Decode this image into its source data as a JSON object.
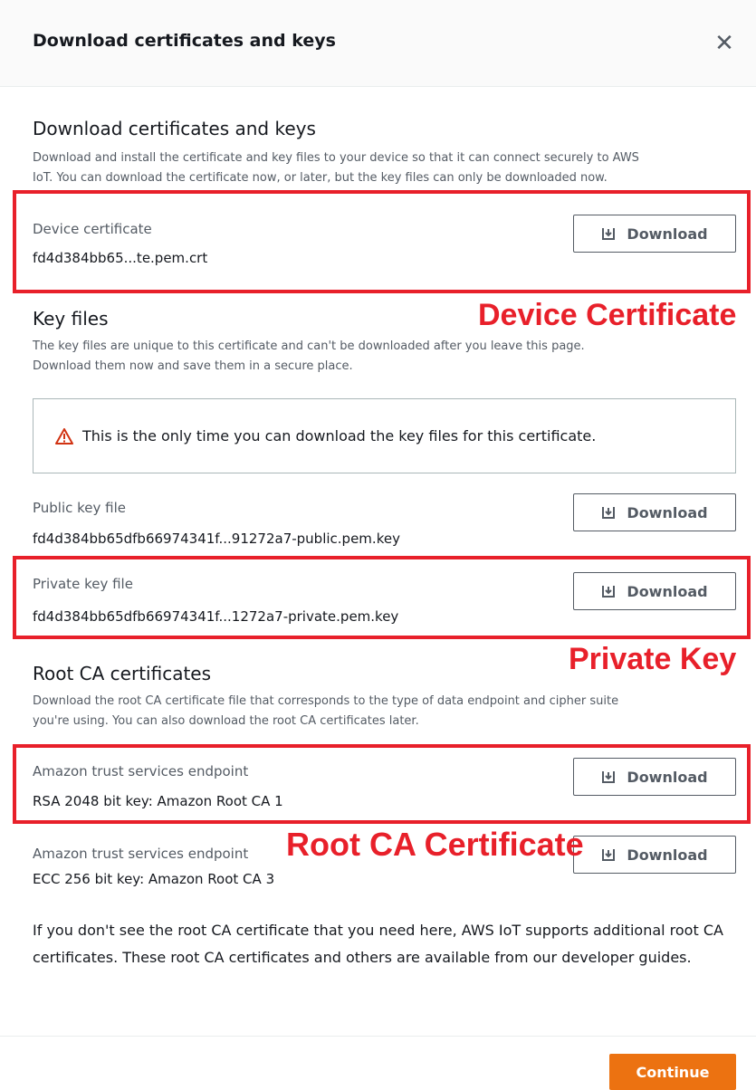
{
  "header": {
    "title": "Download certificates and keys",
    "close_glyph": "✕"
  },
  "intro": {
    "title": "Download certificates and keys",
    "description_line1": "Download and install the certificate and key files to your device so that it can connect securely to AWS",
    "description_line2": "IoT. You can download the certificate now, or later, but the key files can only be downloaded now."
  },
  "device_certificate": {
    "label": "Device certificate",
    "value": "fd4d384bb65...te.pem.crt",
    "button": "Download"
  },
  "key_files": {
    "title": "Key files",
    "description_line1": "The key files are unique to this certificate and can't be downloaded after you leave this page.",
    "description_line2": "Download them now and save them in a secure place.",
    "alert": "This is the only time you can download the key files for this certificate.",
    "public": {
      "label": "Public key file",
      "value": "fd4d384bb65dfb66974341f...91272a7-public.pem.key",
      "button": "Download"
    },
    "private": {
      "label": "Private key file",
      "value": "fd4d384bb65dfb66974341f...1272a7-private.pem.key",
      "button": "Download"
    }
  },
  "root_ca": {
    "title": "Root CA certificates",
    "description_line1": "Download the root CA certificate file that corresponds to the type of data endpoint and cipher suite",
    "description_line2": "you're using. You can also download the root CA certificates later.",
    "rsa": {
      "label": "Amazon trust services endpoint",
      "value": "RSA 2048 bit key: Amazon Root CA 1",
      "button": "Download"
    },
    "ecc": {
      "label": "Amazon trust services endpoint",
      "value": "ECC 256 bit key: Amazon Root CA 3",
      "button": "Download"
    }
  },
  "footer_note": "If you don't see the root CA certificate that you need here, AWS IoT supports additional root CA certificates. These root CA certificates and others are available from our developer guides.",
  "continue_button": "Continue",
  "annotations": {
    "device_certificate": "Device Certificate",
    "private_key": "Private Key",
    "root_ca_certificate": "Root CA Certificate"
  },
  "colors": {
    "annotation_red": "#e8202a",
    "primary_orange": "#ec7211",
    "warning_red": "#d13212"
  }
}
